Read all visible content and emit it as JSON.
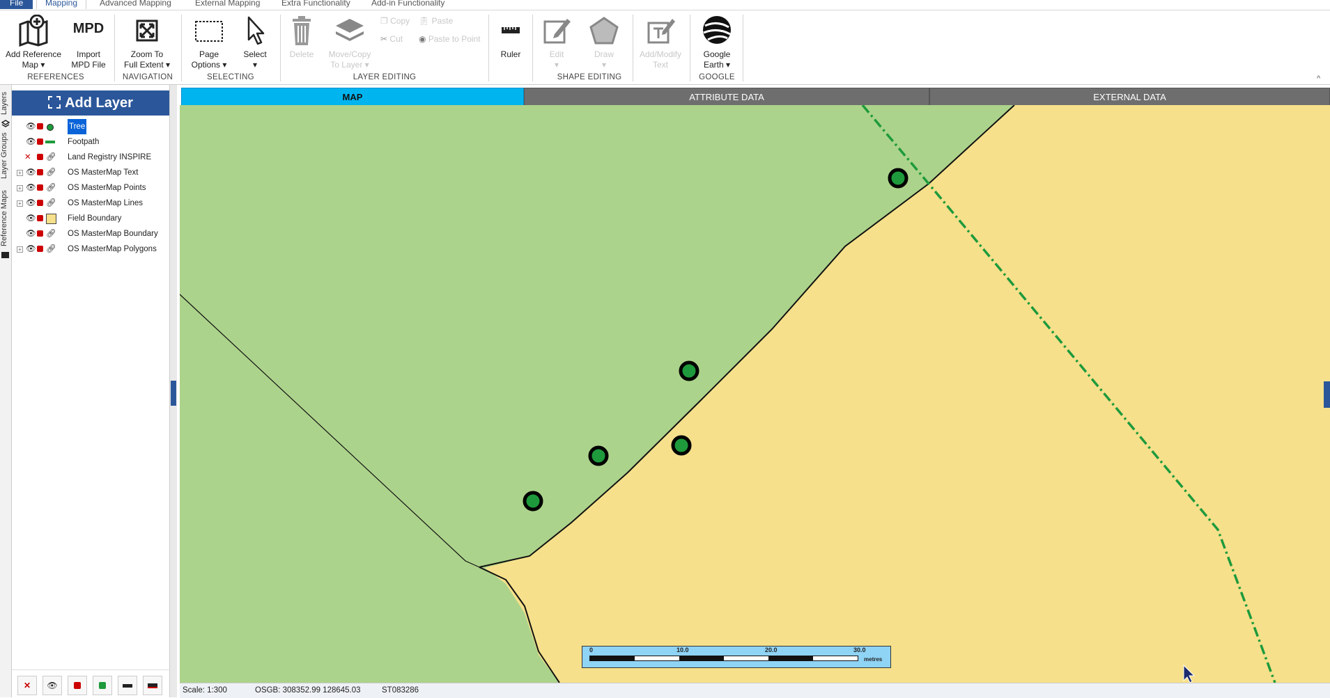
{
  "tabs": {
    "file": "File",
    "mapping": "Mapping",
    "advanced": "Advanced Mapping",
    "external": "External Mapping",
    "extra": "Extra Functionality",
    "addin": "Add-in Functionality"
  },
  "ribbon": {
    "add_ref_1": "Add Reference",
    "add_ref_2": "Map ▾",
    "import_icon_text": "MPD",
    "import_1": "Import",
    "import_2": "MPD File",
    "zoom_1": "Zoom To",
    "zoom_2": "Full Extent ▾",
    "page_1": "Page",
    "page_2": "Options ▾",
    "select_1": "Select",
    "select_2": "▾",
    "delete": "Delete",
    "move_1": "Move/Copy",
    "move_2": "To Layer ▾",
    "copy": "Copy",
    "paste": "Paste",
    "cut": "Cut",
    "paste_point": "Paste to Point",
    "ruler": "Ruler",
    "edit_1": "Edit",
    "edit_2": "▾",
    "draw_1": "Draw",
    "draw_2": "▾",
    "addtext_1": "Add/Modify",
    "addtext_2": "Text",
    "google_1": "Google",
    "google_2": "Earth ▾",
    "groups": {
      "references": "REFERENCES",
      "navigation": "NAVIGATION",
      "selecting": "SELECTING",
      "layer_editing": "LAYER EDITING",
      "shape_editing": "SHAPE EDITING",
      "google": "GOOGLE"
    }
  },
  "vtabs": {
    "layers": "Layers",
    "layer_groups": "Layer Groups",
    "reference_maps": "Reference Maps"
  },
  "panel": {
    "add_layer": "Add Layer"
  },
  "layers": [
    {
      "name": "Tree",
      "selected": true
    },
    {
      "name": "Footpath"
    },
    {
      "name": "Land Registry INSPIRE"
    },
    {
      "name": "OS MasterMap Text"
    },
    {
      "name": "OS MasterMap Points"
    },
    {
      "name": "OS MasterMap Lines"
    },
    {
      "name": "Field Boundary"
    },
    {
      "name": "OS MasterMap Boundary"
    },
    {
      "name": "OS MasterMap Polygons"
    }
  ],
  "view_tabs": {
    "map": "MAP",
    "attribute": "ATTRIBUTE DATA",
    "external": "EXTERNAL DATA"
  },
  "scalebar": {
    "t0": "0",
    "t1": "10.0",
    "t2": "20.0",
    "t3": "30.0",
    "unit": "metres"
  },
  "status": {
    "scale": "Scale: 1:300",
    "coords": "OSGB: 308352.99  128645.03",
    "grid": "ST083286"
  },
  "colors": {
    "accent": "#2b579a",
    "green": "#acd38b",
    "yellow": "#f6e08b",
    "tab_active": "#00b4f0",
    "tab_inactive": "#6e6e6e"
  }
}
